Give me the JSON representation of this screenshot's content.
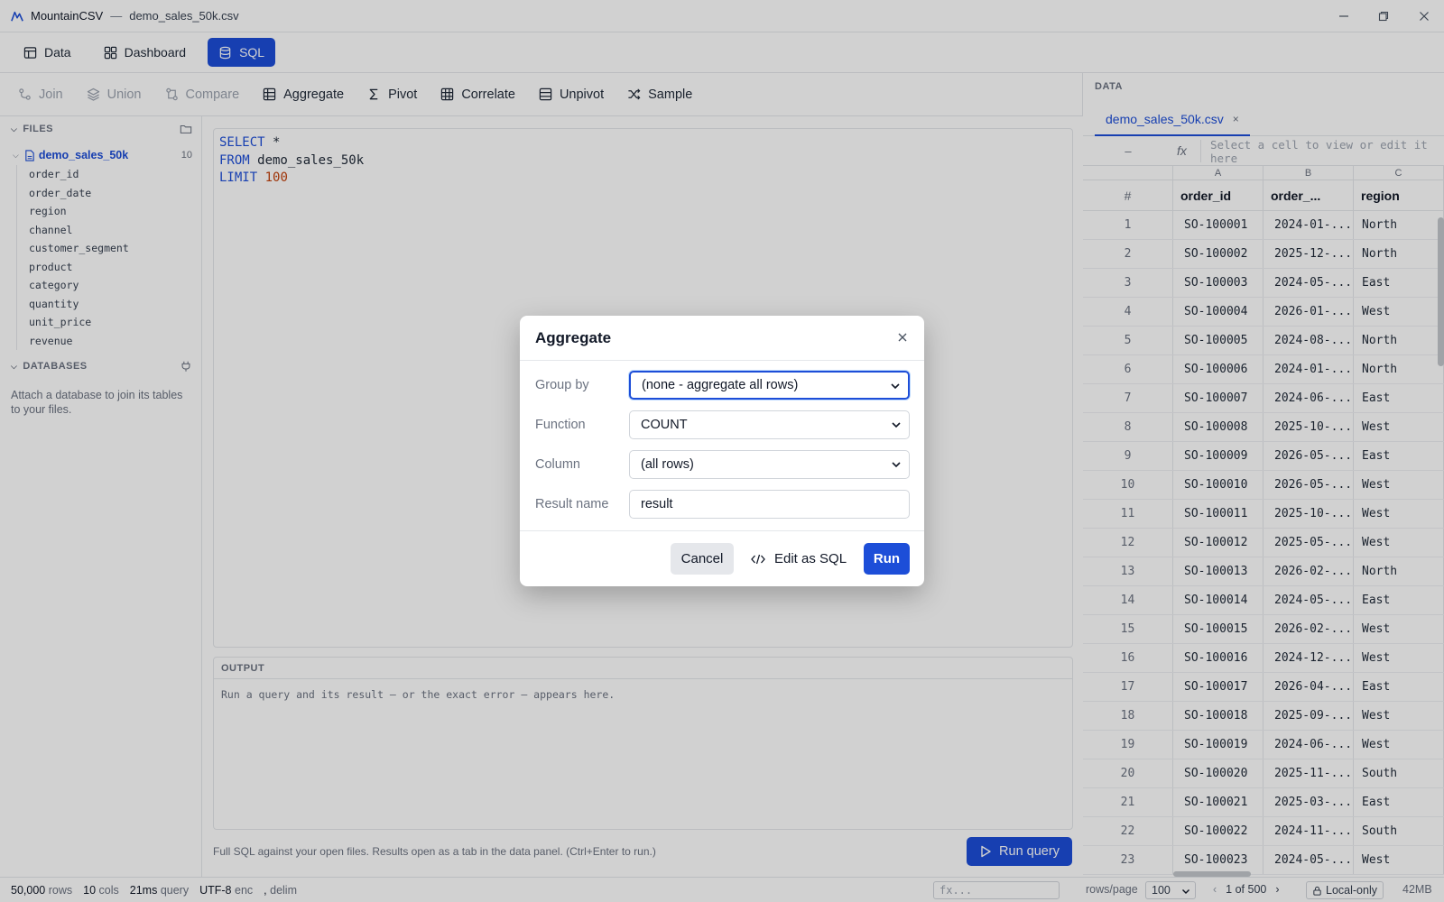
{
  "titlebar": {
    "app_name": "MountainCSV",
    "separator": "—",
    "file_name": "demo_sales_50k.csv"
  },
  "main_tabs": [
    {
      "label": "Data",
      "icon": "table-icon",
      "active": false
    },
    {
      "label": "Dashboard",
      "icon": "dashboard-icon",
      "active": false
    },
    {
      "label": "SQL",
      "icon": "database-icon",
      "active": true
    }
  ],
  "toolbar": {
    "join": "Join",
    "union": "Union",
    "compare": "Compare",
    "aggregate": "Aggregate",
    "pivot": "Pivot",
    "correlate": "Correlate",
    "unpivot": "Unpivot",
    "sample": "Sample"
  },
  "sidebar": {
    "files_header": "FILES",
    "file": {
      "name": "demo_sales_50k",
      "count": "10"
    },
    "columns": [
      "order_id",
      "order_date",
      "region",
      "channel",
      "customer_segment",
      "product",
      "category",
      "quantity",
      "unit_price",
      "revenue"
    ],
    "databases_header": "DATABASES",
    "databases_note": "Attach a database to join its tables to your files."
  },
  "editor": {
    "l1_kw": "SELECT",
    "l1_rest": " *",
    "l2_kw": "FROM",
    "l2_rest": " demo_sales_50k",
    "l3_kw": "LIMIT",
    "l3_num": "100"
  },
  "output": {
    "header": "OUTPUT",
    "hint": "Run a query and its result — or the exact error — appears here."
  },
  "sql_hint": "Full SQL against your open files. Results open as a tab in the data panel. (Ctrl+Enter to run.)",
  "run_query_label": "Run query",
  "data_panel": {
    "header": "DATA",
    "tab_label": "demo_sales_50k.csv",
    "tab_close": "×",
    "cell_ref": "–",
    "fx_label": "fx",
    "fx_placeholder": "Select a cell to view or edit it here",
    "col_letters": [
      "A",
      "B",
      "C"
    ],
    "col_headers": [
      "#",
      "order_id",
      "order_...",
      "region"
    ],
    "rows": [
      [
        "1",
        "SO-100001",
        "2024-01-...",
        "North"
      ],
      [
        "2",
        "SO-100002",
        "2025-12-...",
        "North"
      ],
      [
        "3",
        "SO-100003",
        "2024-05-...",
        "East"
      ],
      [
        "4",
        "SO-100004",
        "2026-01-...",
        "West"
      ],
      [
        "5",
        "SO-100005",
        "2024-08-...",
        "North"
      ],
      [
        "6",
        "SO-100006",
        "2024-01-...",
        "North"
      ],
      [
        "7",
        "SO-100007",
        "2024-06-...",
        "East"
      ],
      [
        "8",
        "SO-100008",
        "2025-10-...",
        "West"
      ],
      [
        "9",
        "SO-100009",
        "2026-05-...",
        "East"
      ],
      [
        "10",
        "SO-100010",
        "2026-05-...",
        "West"
      ],
      [
        "11",
        "SO-100011",
        "2025-10-...",
        "West"
      ],
      [
        "12",
        "SO-100012",
        "2025-05-...",
        "West"
      ],
      [
        "13",
        "SO-100013",
        "2026-02-...",
        "North"
      ],
      [
        "14",
        "SO-100014",
        "2024-05-...",
        "East"
      ],
      [
        "15",
        "SO-100015",
        "2026-02-...",
        "West"
      ],
      [
        "16",
        "SO-100016",
        "2024-12-...",
        "West"
      ],
      [
        "17",
        "SO-100017",
        "2026-04-...",
        "East"
      ],
      [
        "18",
        "SO-100018",
        "2025-09-...",
        "West"
      ],
      [
        "19",
        "SO-100019",
        "2024-06-...",
        "West"
      ],
      [
        "20",
        "SO-100020",
        "2025-11-...",
        "South"
      ],
      [
        "21",
        "SO-100021",
        "2025-03-...",
        "East"
      ],
      [
        "22",
        "SO-100022",
        "2024-11-...",
        "South"
      ],
      [
        "23",
        "SO-100023",
        "2024-05-...",
        "West"
      ]
    ]
  },
  "status": {
    "rows_val": "50,000",
    "rows_lab": "rows",
    "cols_val": "10",
    "cols_lab": "cols",
    "query_val": "21ms",
    "query_lab": "query",
    "enc_val": "UTF-8",
    "enc_lab": "enc",
    "delim_val": ",",
    "delim_lab": "delim",
    "fx_placeholder": "fx...",
    "rows_per_page_label": "rows/page",
    "rows_per_page": "100",
    "page_prev": "‹",
    "page_info": "1 of 500",
    "page_next": "›",
    "local_only": "Local-only",
    "memory": "42MB"
  },
  "modal": {
    "title": "Aggregate",
    "group_by_label": "Group by",
    "group_by_value": "(none - aggregate all rows)",
    "function_label": "Function",
    "function_value": "COUNT",
    "column_label": "Column",
    "column_value": "(all rows)",
    "result_name_label": "Result name",
    "result_name_value": "result",
    "cancel_label": "Cancel",
    "edit_sql_label": "Edit as SQL",
    "run_label": "Run"
  },
  "colors": {
    "accent": "#1d4ed8",
    "border": "#e5e7eb",
    "muted": "#6b7280"
  }
}
